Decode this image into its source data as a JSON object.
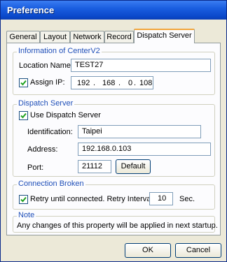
{
  "window": {
    "title": "Preference"
  },
  "tabs": [
    {
      "label": "General"
    },
    {
      "label": "Layout"
    },
    {
      "label": "Network"
    },
    {
      "label": "Record"
    },
    {
      "label": "Dispatch Server",
      "active": true
    }
  ],
  "info_group": {
    "legend": "Information of CenterV2",
    "location_label": "Location Name:",
    "location_value": "TEST27",
    "assign_ip_label": "Assign IP:",
    "assign_ip_checked": true,
    "ip": [
      "192",
      "168",
      "0",
      "108"
    ],
    "ip_dot": "."
  },
  "dispatch_group": {
    "legend": "Dispatch Server",
    "use_label": "Use Dispatch Server",
    "use_checked": true,
    "identification_label": "Identification:",
    "identification_value": "Taipei",
    "address_label": "Address:",
    "address_value": "192.168.0.103",
    "port_label": "Port:",
    "port_value": "21112",
    "default_button": "Default"
  },
  "connection_group": {
    "legend": "Connection Broken",
    "retry_label": "Retry until connected. Retry Interval:",
    "retry_checked": true,
    "interval_value": "10",
    "unit": "Sec."
  },
  "note_group": {
    "legend": "Note",
    "text": "Any changes of this property will be applied in next startup."
  },
  "buttons": {
    "ok": "OK",
    "cancel": "Cancel"
  },
  "colors": {
    "titlebar": "#0a47c9",
    "legend": "#1f4fb8",
    "active_tab_accent": "#f2a53a"
  }
}
